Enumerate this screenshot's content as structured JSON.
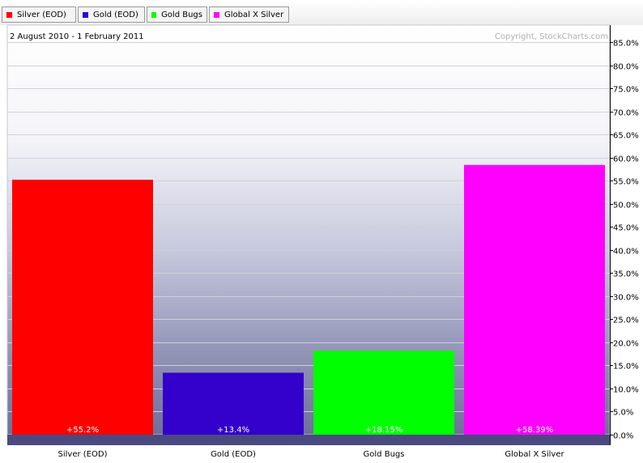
{
  "chart_data": {
    "type": "bar",
    "date_range": "2 August 2010 - 1 February 2011",
    "copyright": "Copyright, StockCharts.com",
    "categories": [
      "Silver (EOD)",
      "Gold (EOD)",
      "Gold Bugs",
      "Global X Silver"
    ],
    "values": [
      55.2,
      13.4,
      18.15,
      58.39
    ],
    "value_labels": [
      "+55.2%",
      "+13.4%",
      "+18.15%",
      "+58.39%"
    ],
    "colors": [
      "#ff0000",
      "#3300cc",
      "#00ff00",
      "#ff00ff"
    ],
    "ylim": [
      0,
      85
    ],
    "yticks": [
      "0.0%",
      "5.0%",
      "10.0%",
      "15.0%",
      "20.0%",
      "25.0%",
      "30.0%",
      "35.0%",
      "40.0%",
      "45.0%",
      "50.0%",
      "55.0%",
      "60.0%",
      "65.0%",
      "70.0%",
      "75.0%",
      "80.0%",
      "85.0%"
    ],
    "ytick_values": [
      0,
      5,
      10,
      15,
      20,
      25,
      30,
      35,
      40,
      45,
      50,
      55,
      60,
      65,
      70,
      75,
      80,
      85
    ],
    "grid": true,
    "legend_placement": "top-left"
  },
  "legend": [
    {
      "label": "Silver (EOD)",
      "color": "#ff0000"
    },
    {
      "label": "Gold (EOD)",
      "color": "#3300cc"
    },
    {
      "label": "Gold Bugs",
      "color": "#00ff00"
    },
    {
      "label": "Global X Silver",
      "color": "#ff00ff"
    }
  ]
}
